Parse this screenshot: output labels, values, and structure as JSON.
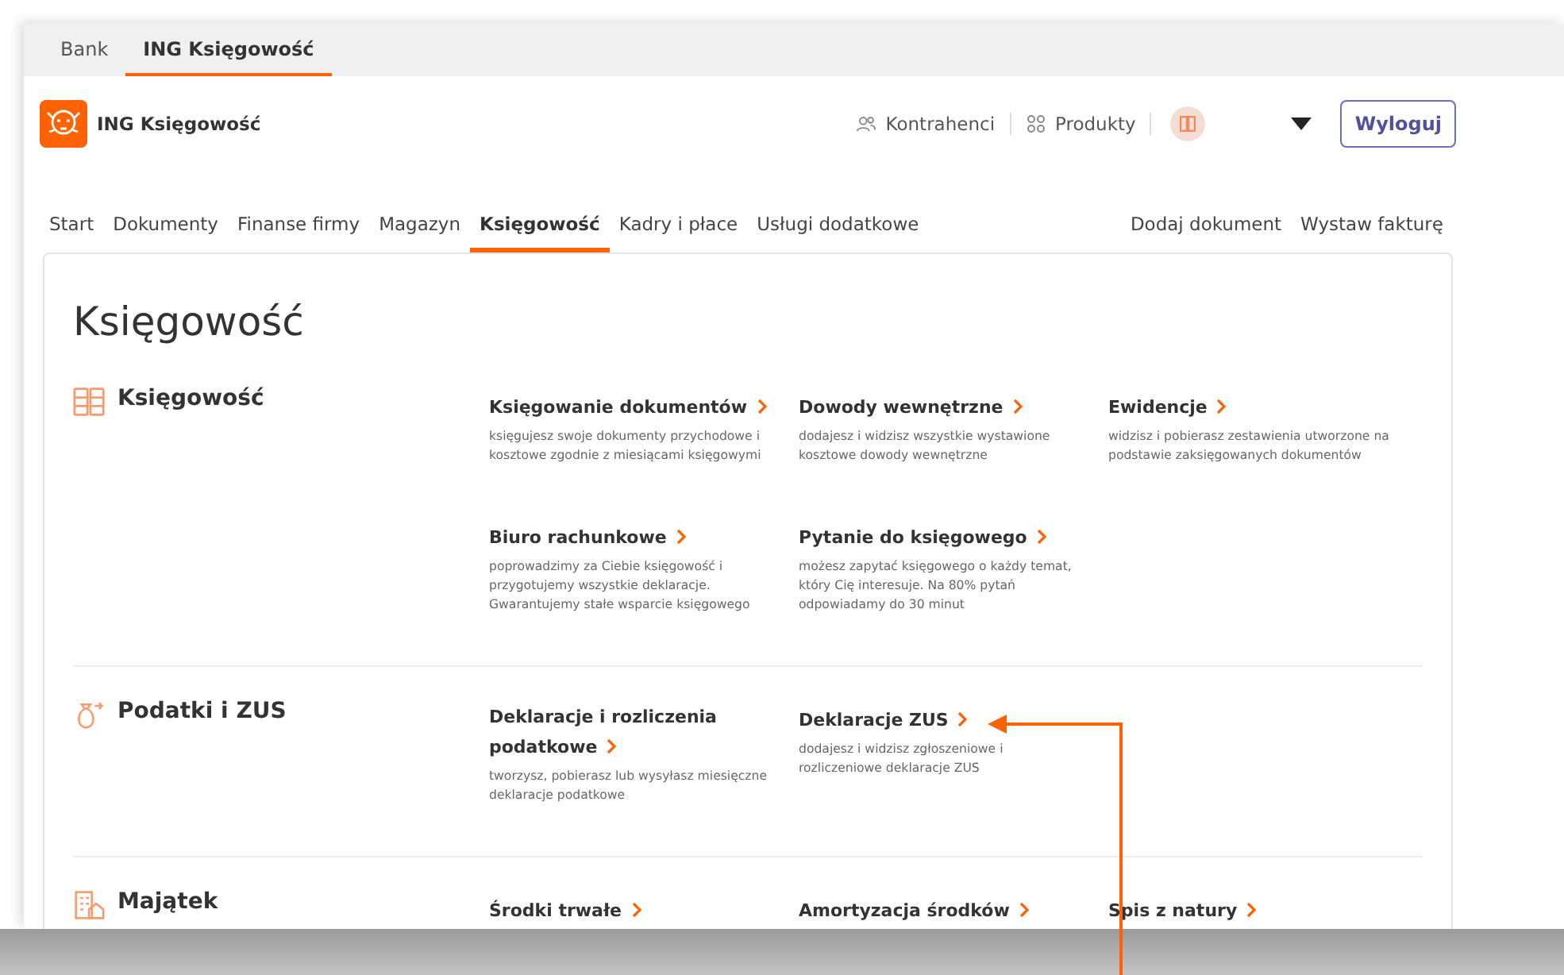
{
  "tabs": [
    {
      "label": "Bank",
      "selected": false
    },
    {
      "label": "ING Księgowość",
      "selected": true
    }
  ],
  "header": {
    "title": "ING Księgowość",
    "links": [
      {
        "label": "Kontrahenci",
        "kind": "people"
      },
      {
        "label": "Produkty",
        "kind": "grid"
      }
    ],
    "logout": "Wyloguj"
  },
  "nav": {
    "items": [
      {
        "label": "Start",
        "selected": false
      },
      {
        "label": "Dokumenty",
        "selected": false
      },
      {
        "label": "Finanse firmy",
        "selected": false
      },
      {
        "label": "Magazyn",
        "selected": false
      },
      {
        "label": "Księgowość",
        "selected": true
      },
      {
        "label": "Kadry i płace",
        "selected": false
      },
      {
        "label": "Usługi dodatkowe",
        "selected": false
      }
    ],
    "actions": [
      "Dodaj dokument",
      "Wystaw fakturę"
    ]
  },
  "page_title": "Księgowość",
  "sections": [
    {
      "title": "Księgowość",
      "kind": "binders",
      "items": [
        {
          "title": "Księgowanie dokumentów",
          "description": "księgujesz swoje dokumenty przychodowe i kosztowe zgodnie z miesiącami księgowymi"
        },
        {
          "title": "Dowody wewnętrzne",
          "description": "dodajesz i widzisz wszystkie wystawione kosztowe dowody wewnętrzne"
        },
        {
          "title": "Ewidencje",
          "description": "widzisz i pobierasz zestawienia utworzone na podstawie zaksięgowanych dokumentów"
        },
        {
          "title": "Biuro rachunkowe",
          "description": "poprowadzimy za Ciebie księgowość i przygotujemy wszystkie deklaracje. Gwarantujemy stałe wsparcie księgowego"
        },
        {
          "title": "Pytanie do księgowego",
          "description": "możesz zapytać księgowego o każdy temat, który Cię interesuje. Na 80% pytań odpowiadamy do 30 minut"
        }
      ]
    },
    {
      "title": "Podatki i ZUS",
      "kind": "moneybag",
      "items": [
        {
          "title": "Deklaracje i rozliczenia podatkowe",
          "description": "tworzysz, pobierasz lub wysyłasz miesięczne deklaracje podatkowe"
        },
        {
          "title": "Deklaracje ZUS",
          "description": "dodajesz i widzisz zgłoszeniowe i rozliczeniowe deklaracje ZUS"
        }
      ]
    },
    {
      "title": "Majątek",
      "kind": "building",
      "items": [
        {
          "title": "Środki trwałe"
        },
        {
          "title": "Amortyzacja środków"
        },
        {
          "title": "Spis z natury"
        }
      ]
    }
  ]
}
